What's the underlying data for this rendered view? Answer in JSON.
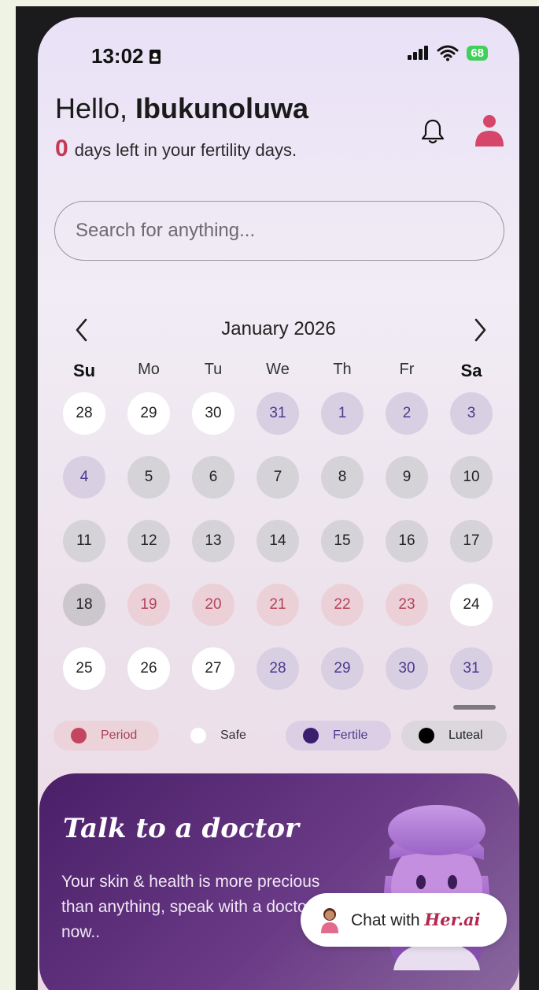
{
  "status_bar": {
    "time": "13:02",
    "battery": "68"
  },
  "header": {
    "greeting_prefix": "Hello, ",
    "user_name": "Ibukunoluwa",
    "days_left_number": "0",
    "days_left_text": "days left in your fertility days."
  },
  "search": {
    "placeholder": "Search for anything..."
  },
  "calendar": {
    "month_label": "January 2026",
    "weekdays": [
      "Su",
      "Mo",
      "Tu",
      "We",
      "Th",
      "Fr",
      "Sa"
    ],
    "weeks": [
      [
        {
          "d": "28",
          "phase": "safe"
        },
        {
          "d": "29",
          "phase": "safe"
        },
        {
          "d": "30",
          "phase": "safe"
        },
        {
          "d": "31",
          "phase": "fertile"
        },
        {
          "d": "1",
          "phase": "fertile"
        },
        {
          "d": "2",
          "phase": "fertile"
        },
        {
          "d": "3",
          "phase": "fertile"
        }
      ],
      [
        {
          "d": "4",
          "phase": "fertile"
        },
        {
          "d": "5",
          "phase": "luteal"
        },
        {
          "d": "6",
          "phase": "luteal"
        },
        {
          "d": "7",
          "phase": "luteal"
        },
        {
          "d": "8",
          "phase": "luteal"
        },
        {
          "d": "9",
          "phase": "luteal"
        },
        {
          "d": "10",
          "phase": "luteal"
        }
      ],
      [
        {
          "d": "11",
          "phase": "luteal"
        },
        {
          "d": "12",
          "phase": "luteal"
        },
        {
          "d": "13",
          "phase": "luteal"
        },
        {
          "d": "14",
          "phase": "luteal"
        },
        {
          "d": "15",
          "phase": "luteal"
        },
        {
          "d": "16",
          "phase": "luteal"
        },
        {
          "d": "17",
          "phase": "luteal"
        }
      ],
      [
        {
          "d": "18",
          "phase": "luteal-dark"
        },
        {
          "d": "19",
          "phase": "period"
        },
        {
          "d": "20",
          "phase": "period"
        },
        {
          "d": "21",
          "phase": "period"
        },
        {
          "d": "22",
          "phase": "period"
        },
        {
          "d": "23",
          "phase": "period"
        },
        {
          "d": "24",
          "phase": "safe"
        }
      ],
      [
        {
          "d": "25",
          "phase": "safe"
        },
        {
          "d": "26",
          "phase": "safe"
        },
        {
          "d": "27",
          "phase": "safe"
        },
        {
          "d": "28",
          "phase": "fertile"
        },
        {
          "d": "29",
          "phase": "fertile"
        },
        {
          "d": "30",
          "phase": "fertile"
        },
        {
          "d": "31",
          "phase": "fertile"
        }
      ]
    ]
  },
  "legend": [
    {
      "label": "Period",
      "color": "#c4455e",
      "bg": "#ecd3d9",
      "text": "#a9425a"
    },
    {
      "label": "Safe",
      "color": "#ffffff",
      "bg": "transparent",
      "text": "#333333"
    },
    {
      "label": "Fertile",
      "color": "#3a1f6e",
      "bg": "#dccfe5",
      "text": "#4b3a8c"
    },
    {
      "label": "Luteal",
      "color": "#000000",
      "bg": "#dcd7dc",
      "text": "#222222"
    }
  ],
  "doctor_card": {
    "title": "Talk to a doctor",
    "body": "Your skin & health is more precious than anything, speak with a doctor now..",
    "chat_prefix": "Chat with ",
    "chat_brand": "Her.ai"
  },
  "icons": [
    "bell-icon",
    "profile-icon",
    "chevron-left-icon",
    "chevron-right-icon",
    "doctor-illustration",
    "assistant-avatar-icon"
  ]
}
